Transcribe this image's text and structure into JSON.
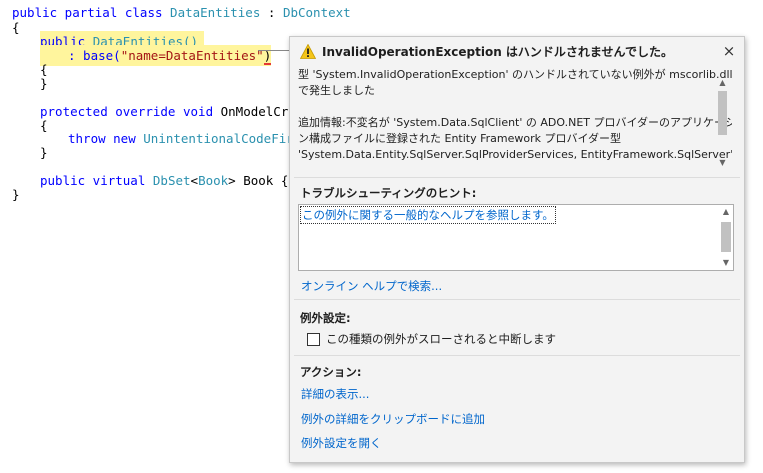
{
  "code": {
    "line1": {
      "p1": "public partial class ",
      "p2": "DataEntities",
      "p3": " : ",
      "p4": "DbContext"
    },
    "line2": {
      "p1": "{"
    },
    "line3": {
      "p1": "public ",
      "p2": "DataEntities()"
    },
    "line4": {
      "p1": ": base(",
      "p2": "\"name=DataEntities\"",
      "p3": ")"
    },
    "line5": {
      "p1": "{"
    },
    "line6": {
      "p1": "}"
    },
    "line7": {
      "p1": "protected override void ",
      "p2": "OnModelCreat"
    },
    "line8": {
      "p1": "{"
    },
    "line9": {
      "p1": "throw new ",
      "p2": "UnintentionalCodeFirst"
    },
    "line10": {
      "p1": "}"
    },
    "line11": {
      "p1": "public virtual ",
      "p2": "DbSet",
      "p3": "<",
      "p4": "Book",
      "p5": "> Book { ge"
    },
    "line12": {
      "p1": "}"
    }
  },
  "exception_popup": {
    "title": "InvalidOperationException はハンドルされませんでした。",
    "close_glyph": "×",
    "warning_icon": "warning-triangle-icon",
    "message_lines": [
      "型 'System.InvalidOperationException' のハンドルされていない例外が mscorlib.dll",
      "で発生しました",
      "",
      "追加情報:不変名が 'System.Data.SqlClient' の ADO.NET プロバイダーのアプリケーショ",
      "ン構成ファイルに登録された Entity Framework プロバイダー型",
      "'System.Data.Entity.SqlServer.SqlProviderServices, EntityFramework.SqlServer'"
    ],
    "hints_header": "トラブルシューティングのヒント:",
    "hint_link": "この例外に関する一般的なヘルプを参照します。",
    "online_help_link": "オンライン ヘルプで検索...",
    "exception_settings_header": "例外設定:",
    "break_checkbox_label": "この種類の例外がスローされると中断します",
    "break_checked": false,
    "actions_header": "アクション:",
    "actions": [
      "詳細の表示...",
      "例外の詳細をクリップボードに追加",
      "例外設定を開く"
    ]
  },
  "colors": {
    "keyword": "#0000ff",
    "type": "#2b91af",
    "string": "#a31515",
    "highlight": "#fff59d",
    "link": "#0066cc",
    "warning": "#f5c518"
  }
}
